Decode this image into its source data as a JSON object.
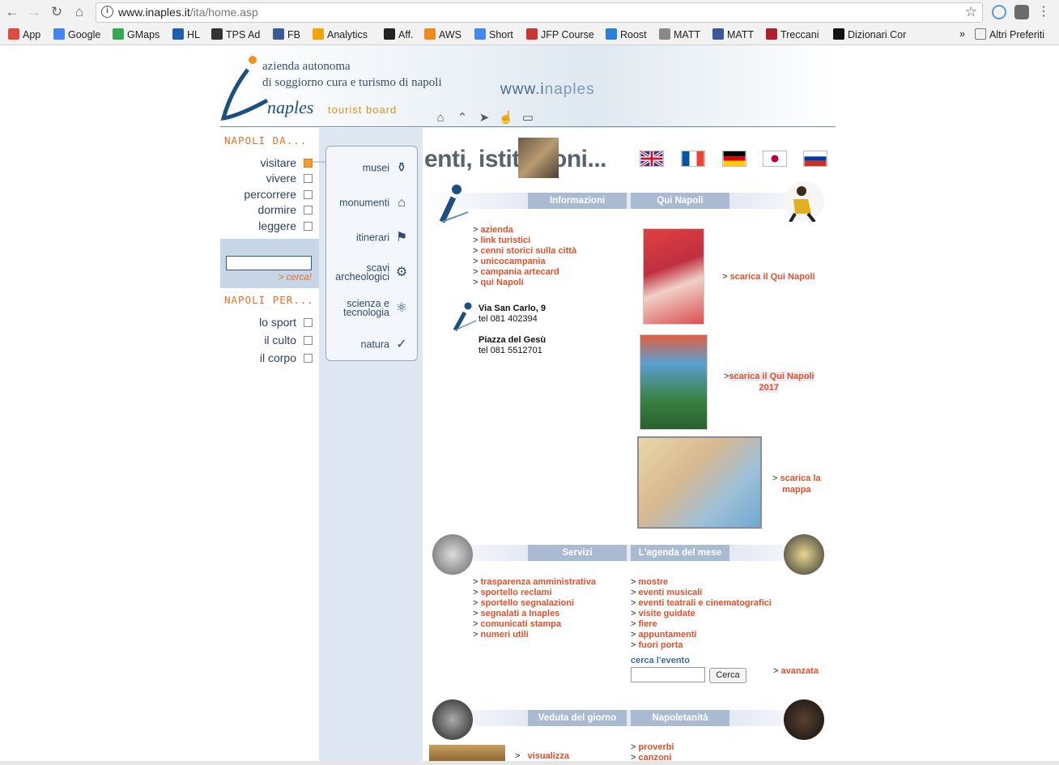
{
  "browser": {
    "url_host": "www.inaples.it",
    "url_path": "/ita/home.asp",
    "bookmarks": [
      {
        "label": "App",
        "color": "#e04a3a"
      },
      {
        "label": "Google",
        "color": "#4285f4"
      },
      {
        "label": "GMaps",
        "color": "#34a853"
      },
      {
        "label": "HL",
        "color": "#1a5fb4"
      },
      {
        "label": "TPS Ad",
        "color": "#333333"
      },
      {
        "label": "FB",
        "color": "#3b5998"
      },
      {
        "label": "Analytics",
        "color": "#f4a400"
      },
      {
        "label": "Aff.",
        "color": "#222222"
      },
      {
        "label": "AWS",
        "color": "#f08a1c"
      },
      {
        "label": "Short",
        "color": "#4285f4"
      },
      {
        "label": "JFP Course",
        "color": "#cc3333"
      },
      {
        "label": "Roost",
        "color": "#2a7fd8"
      },
      {
        "label": "MATT",
        "color": "#888888"
      },
      {
        "label": "MATT",
        "color": "#3b5998"
      },
      {
        "label": "Treccani",
        "color": "#b0202a"
      },
      {
        "label": "Dizionari Cor",
        "color": "#111111"
      }
    ],
    "overflow_label": "»",
    "other_bookmarks": "Altri Preferiti"
  },
  "header": {
    "brand_line1": "azienda autonoma",
    "brand_line2": "di soggiorno cura e turismo di napoli",
    "brand_name": "naples",
    "tourist_board": "tourist board",
    "www_prefix": "www.i",
    "www_suffix": "naples"
  },
  "left": {
    "napoli_da": "NAPOLI  DA...",
    "da_links": [
      "visitare",
      "vivere",
      "percorrere",
      "dormire",
      "leggere"
    ],
    "search_go": "> cerca!",
    "napoli_per": "NAPOLI PER...",
    "per_links": [
      "lo sport",
      "il culto",
      "il corpo"
    ]
  },
  "menu": {
    "items": [
      {
        "label1": "musei",
        "label2": ""
      },
      {
        "label1": "monumenti",
        "label2": ""
      },
      {
        "label1": "itinerari",
        "label2": ""
      },
      {
        "label1": "scavi",
        "label2": "archeologici"
      },
      {
        "label1": "scienza e",
        "label2": "tecnologia"
      },
      {
        "label1": "natura",
        "label2": ""
      }
    ]
  },
  "content": {
    "title": "enti, istituzioni...",
    "info_tab": "Informazioni",
    "qui_tab": "Qui Napoli",
    "info_links": [
      "azienda",
      "link turistici",
      "cenni storici sulla città",
      "unicocampania",
      "campania artecard",
      "qui Napoli"
    ],
    "addr1_street": "Via San Carlo, 9",
    "addr1_tel": "tel 081 402394",
    "addr2_street": "Piazza del Gesù",
    "addr2_tel": "tel 081 5512701",
    "dl1": "scarica il Qui Napoli",
    "dl2_line1": "scarica il Qui Napoli",
    "dl2_line2": "2017",
    "dl3_line1": "scarica la",
    "dl3_line2": "mappa",
    "servizi_tab": "Servizi",
    "agenda_tab": "L'agenda del mese",
    "servizi_links": [
      "trasparenza amministrativa",
      "sportello reclami",
      "sportello segnalazioni",
      "segnalati a Inaples",
      "comunicati stampa",
      "numeri utili"
    ],
    "agenda_links": [
      "mostre",
      "eventi musicali",
      "eventi teatrali e cinematografici",
      "visite guidate",
      "fiere",
      "appuntamenti",
      "fuori porta"
    ],
    "cerca_evento": "cerca l'evento",
    "cerca_btn": "Cerca",
    "avanzata": "avanzata",
    "veduta_tab": "Veduta del giorno",
    "napoletanita_tab": "Napoletanità",
    "visualizza": "visualizza",
    "napoletanita_links": [
      "proverbi",
      "canzoni"
    ]
  }
}
